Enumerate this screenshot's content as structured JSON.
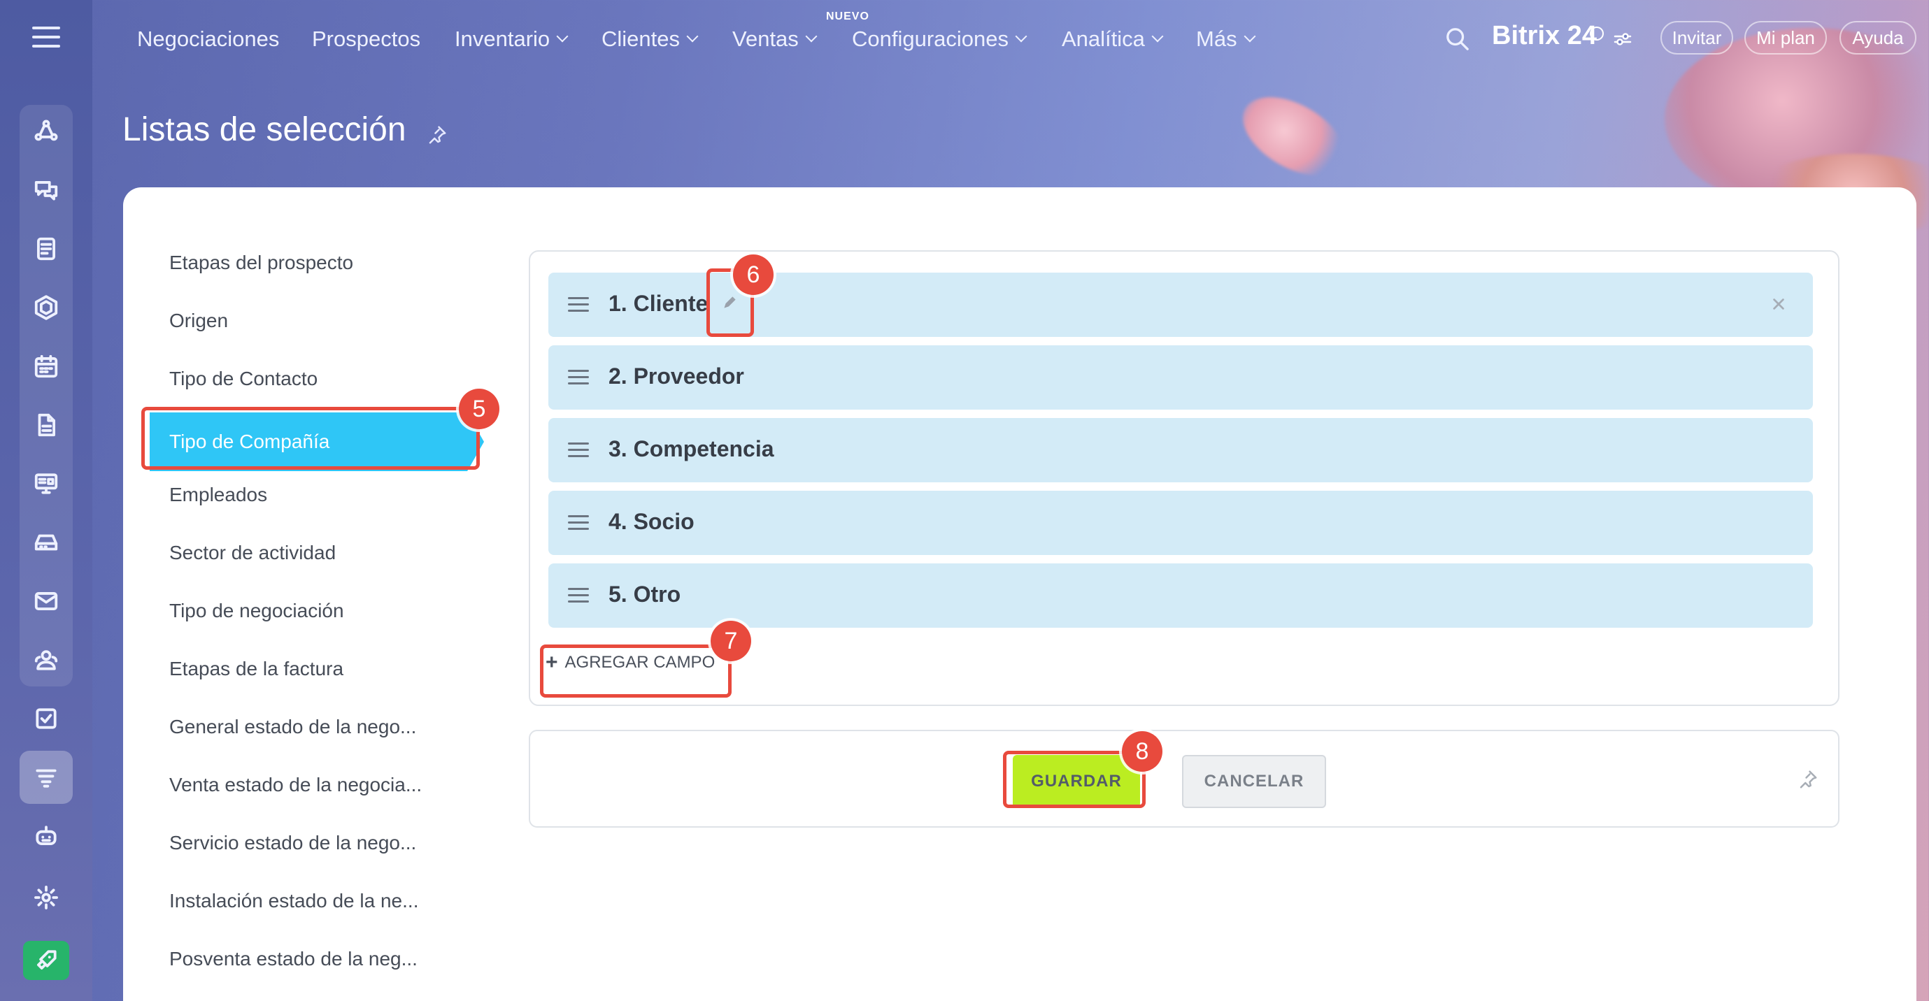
{
  "nav": {
    "items": [
      {
        "label": "Negociaciones"
      },
      {
        "label": "Prospectos"
      },
      {
        "label": "Inventario"
      },
      {
        "label": "Clientes"
      },
      {
        "label": "Ventas"
      },
      {
        "label": "Configuraciones"
      },
      {
        "label": "Analítica"
      },
      {
        "label": "Más"
      }
    ],
    "new_badge": "NUEVO",
    "brand": "Bitrix 24",
    "invite": "Invitar",
    "plan": "Mi plan",
    "help": "Ayuda"
  },
  "page": {
    "title": "Listas de selección"
  },
  "left_menu": {
    "items": [
      "Etapas del prospecto",
      "Origen",
      "Tipo de Contacto",
      "Tipo de Compañía",
      "Empleados",
      "Sector de actividad",
      "Tipo de negociación",
      "Etapas de la factura",
      "General estado de la nego...",
      "Venta estado de la negocia...",
      "Servicio estado de la nego...",
      "Instalación estado de la ne...",
      "Posventa estado de la neg..."
    ],
    "selected": "Tipo de Compañía"
  },
  "entries": [
    "1. Cliente",
    "2. Proveedor",
    "3. Competencia",
    "4. Socio",
    "5. Otro"
  ],
  "add_field": {
    "plus": "+",
    "label": "AGREGAR CAMPO"
  },
  "buttons": {
    "save": "GUARDAR",
    "cancel": "CANCELAR"
  },
  "annotations": [
    "5",
    "6",
    "7",
    "8"
  ],
  "colors": {
    "selected_item": "#2fc6f6",
    "entry_bg": "#d3ebf7",
    "save_button": "#bbed21",
    "annotation": "#e84a3d",
    "sidebar_active_green": "#27b46a"
  }
}
